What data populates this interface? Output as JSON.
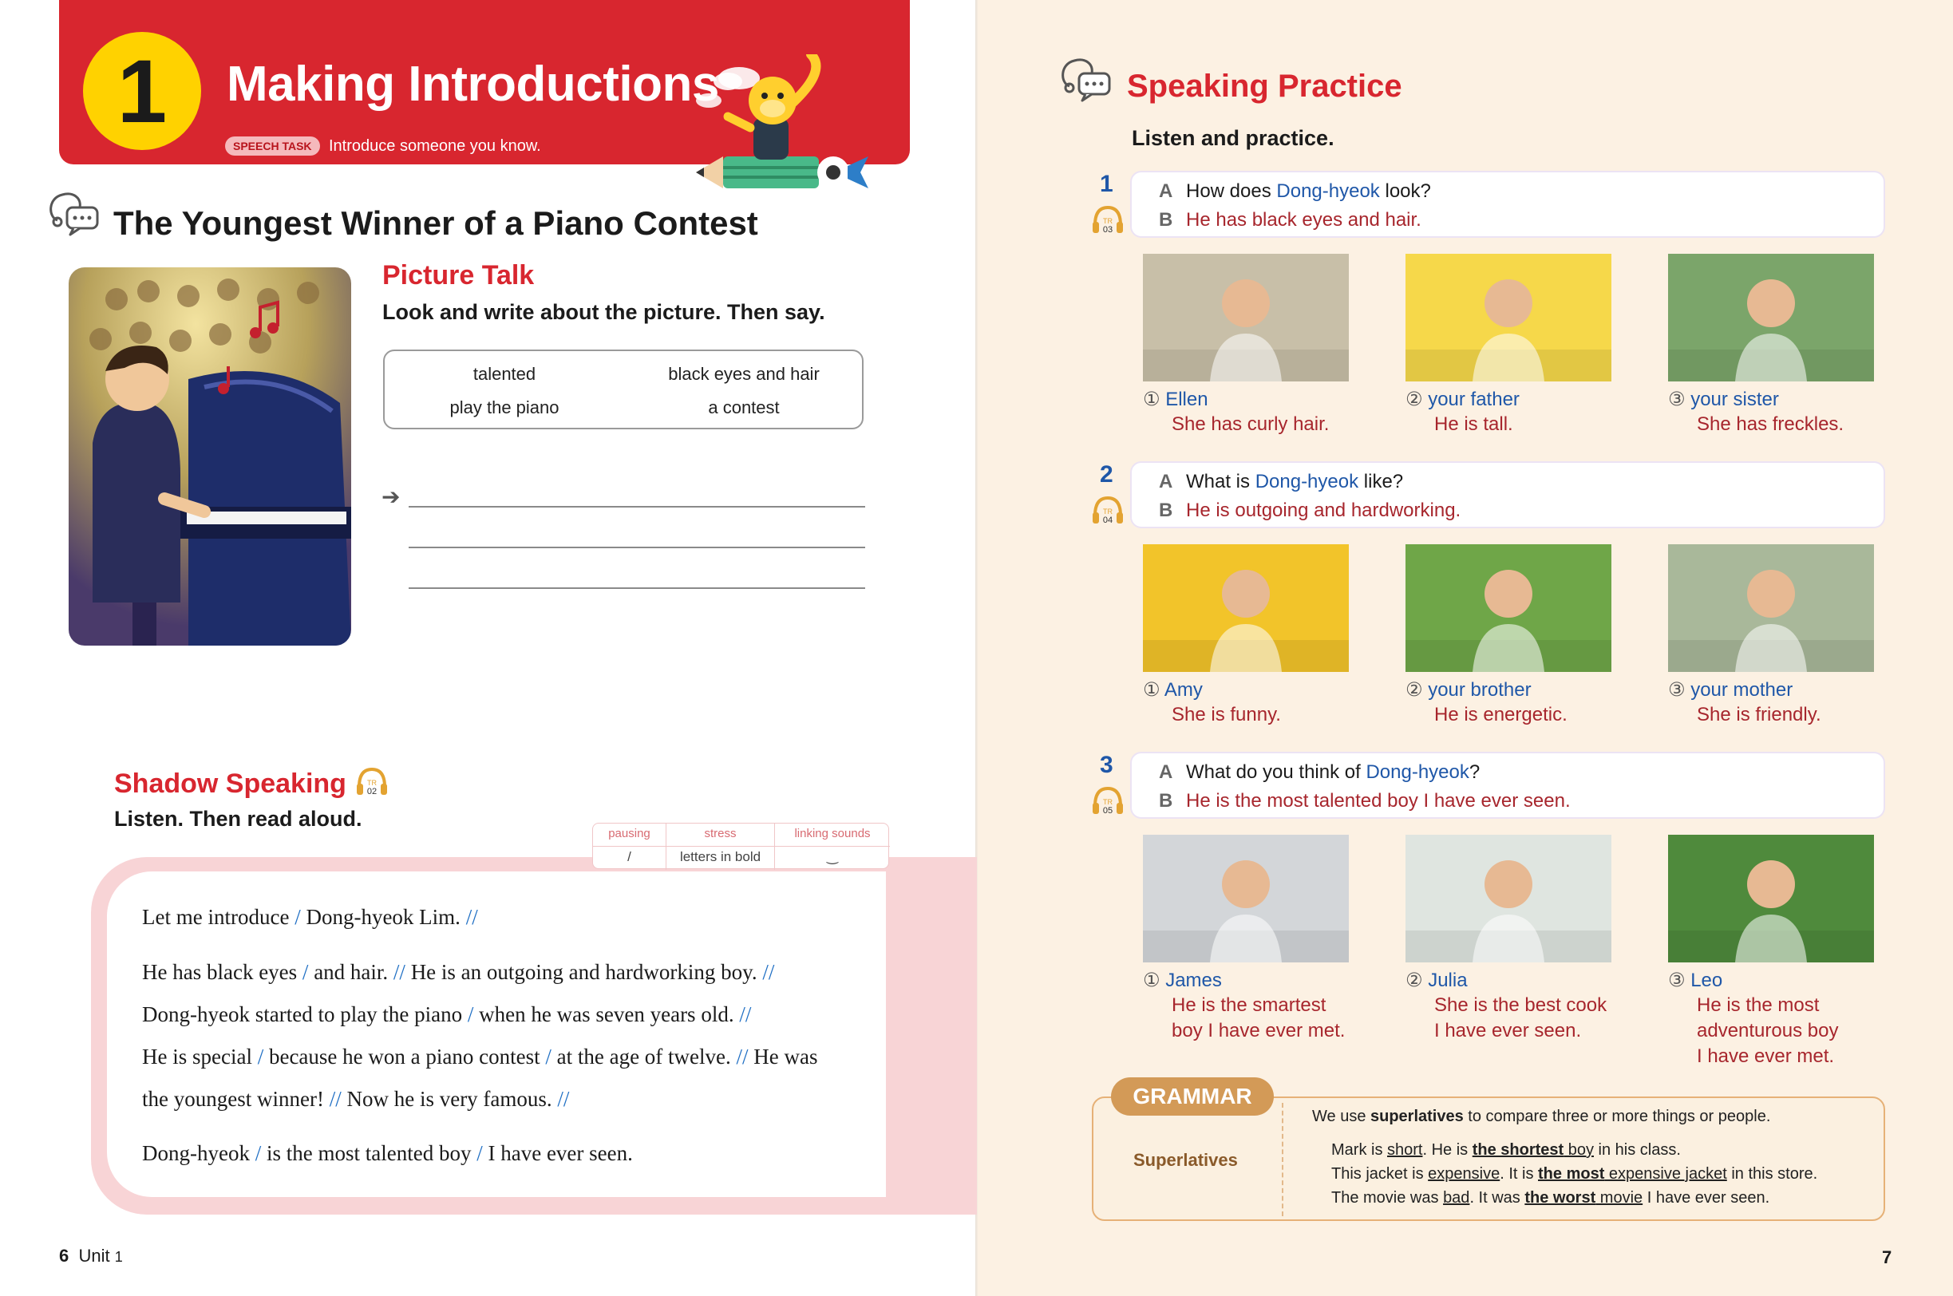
{
  "unit": {
    "number": "1",
    "title": "Making Introductions",
    "speech_task_badge": "SPEECH TASK",
    "speech_task_text": "Introduce someone you know."
  },
  "left": {
    "section_title": "The Youngest Winner of a Piano Contest",
    "picture_talk": {
      "heading": "Picture Talk",
      "instruction": "Look and write about the picture. Then say.",
      "words": [
        "talented",
        "black eyes and hair",
        "play the piano",
        "a contest"
      ]
    },
    "shadow_speaking": {
      "heading": "Shadow Speaking",
      "track": {
        "tr": "TR",
        "num": "02"
      },
      "instruction": "Listen. Then read aloud.",
      "legend": {
        "headers": [
          "pausing",
          "stress",
          "linking sounds"
        ],
        "values": [
          "/",
          "letters in bold",
          "‿"
        ]
      }
    },
    "passage": [
      "Let me introduce / Dong-hyeok Lim. //",
      "He has black eyes / and hair. // He is an outgoing and hardworking boy. //",
      "Dong-hyeok started to play the piano / when he was seven years old. //",
      "He is special / because he won a piano contest / at the age of twelve. // He was",
      "the youngest winner! // Now he is very famous. //",
      "Dong-hyeok / is the most talented boy / I have ever seen."
    ],
    "folio": {
      "page": "6",
      "unit_label": "Unit",
      "unit_num": "1"
    }
  },
  "right": {
    "section_title": "Speaking Practice",
    "instruction": "Listen and practice.",
    "items": [
      {
        "num": "1",
        "track": "03",
        "a_label": "A",
        "a_pre": "How does ",
        "a_name": "Dong-hyeok",
        "a_post": " look?",
        "b_label": "B",
        "b_text": "He has black eyes and hair.",
        "options": [
          {
            "marker": "①",
            "name": "Ellen",
            "lines": [
              "She has curly hair."
            ]
          },
          {
            "marker": "②",
            "name": "your father",
            "lines": [
              "He is tall."
            ]
          },
          {
            "marker": "③",
            "name": "your sister",
            "lines": [
              "She has freckles."
            ]
          }
        ]
      },
      {
        "num": "2",
        "track": "04",
        "a_label": "A",
        "a_pre": "What is ",
        "a_name": "Dong-hyeok",
        "a_post": " like?",
        "b_label": "B",
        "b_text": "He is outgoing and hardworking.",
        "options": [
          {
            "marker": "①",
            "name": "Amy",
            "lines": [
              "She is funny."
            ]
          },
          {
            "marker": "②",
            "name": "your brother",
            "lines": [
              "He is energetic."
            ]
          },
          {
            "marker": "③",
            "name": "your mother",
            "lines": [
              "She is friendly."
            ]
          }
        ]
      },
      {
        "num": "3",
        "track": "05",
        "a_label": "A",
        "a_pre": "What do you think of ",
        "a_name": "Dong-hyeok",
        "a_post": "?",
        "b_label": "B",
        "b_text": "He is the most talented boy I have ever seen.",
        "options": [
          {
            "marker": "①",
            "name": "James",
            "lines": [
              "He is the smartest",
              "boy I have ever met."
            ]
          },
          {
            "marker": "②",
            "name": "Julia",
            "lines": [
              "She is the best cook",
              "I have ever seen."
            ]
          },
          {
            "marker": "③",
            "name": "Leo",
            "lines": [
              "He is the most",
              "adventurous boy",
              "I have ever met."
            ]
          }
        ]
      }
    ],
    "grammar": {
      "tab": "GRAMMAR",
      "topic": "Superlatives",
      "rule_pre": "We use ",
      "rule_bold": "superlatives",
      "rule_post": " to compare three or more things or people.",
      "ex1": {
        "a": "Mark is ",
        "b": "short",
        "c": ". He is ",
        "d": "the shortest",
        "e": " boy",
        "f": " in his class."
      },
      "ex2": {
        "a": "This jacket is ",
        "b": "expensive",
        "c": ". It is ",
        "d": "the most",
        "e": " expensive jacket",
        "f": " in this store."
      },
      "ex3": {
        "a": "The movie was ",
        "b": "bad",
        "c": ". It was ",
        "d": "the worst",
        "e": " movie",
        "f": " I have ever seen."
      }
    },
    "folio": {
      "page": "7"
    }
  },
  "colors": {
    "brand_red": "#d8262f",
    "name_blue": "#1f57a8",
    "answer_red": "#a7262d",
    "grammar_tan": "#d39a57"
  }
}
